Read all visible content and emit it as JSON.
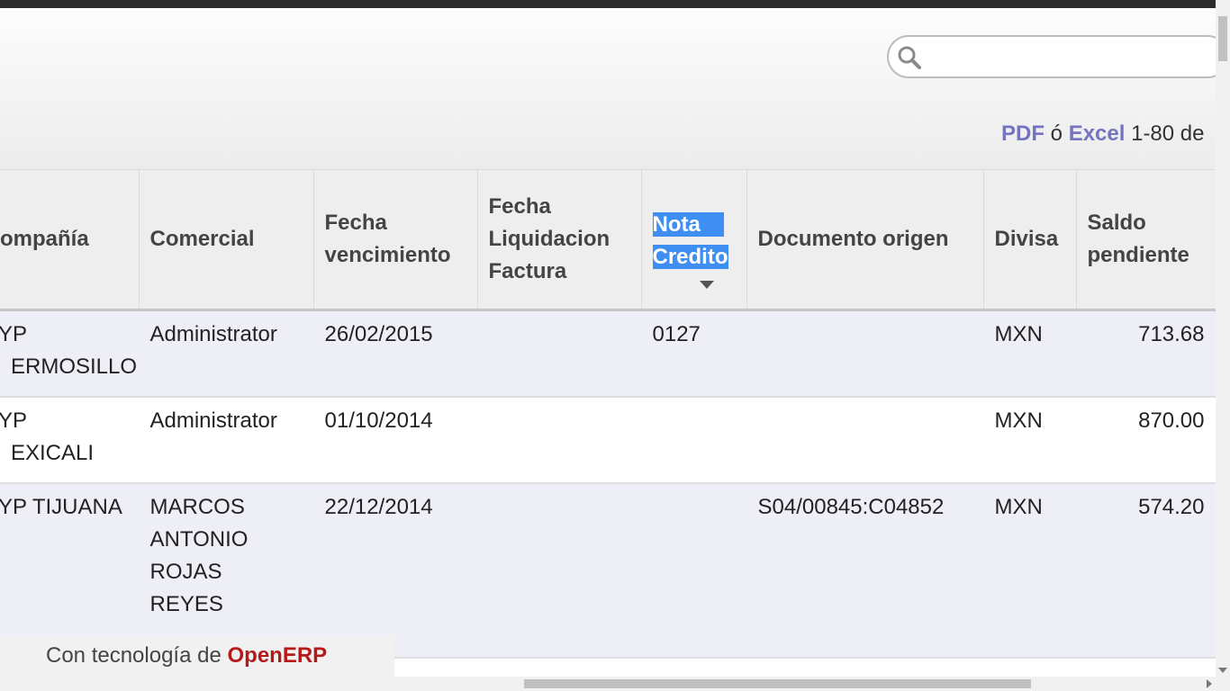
{
  "search": {
    "value": "",
    "placeholder": ""
  },
  "pager": {
    "pdf": "PDF",
    "sep": "ó",
    "excel": "Excel",
    "range": "1-80 de"
  },
  "columns": {
    "company": "ompañía",
    "salesperson": "Comercial",
    "due_date": [
      "Fecha",
      "vencimiento"
    ],
    "settlement_date": [
      "Fecha",
      "Liquidacion",
      "Factura"
    ],
    "credit_note": [
      "Nota",
      "Credito"
    ],
    "source_document": "Documento origen",
    "currency": "Divisa",
    "balance": [
      "Saldo",
      "pendiente"
    ]
  },
  "rows": [
    {
      "company": [
        "YP",
        "ERMOSILLO"
      ],
      "salesperson": [
        "Administrator"
      ],
      "due_date": "26/02/2015",
      "settlement_date": "",
      "credit_note": "0127",
      "source_document": "",
      "currency": "MXN",
      "balance": "713.68"
    },
    {
      "company": [
        "YP",
        "EXICALI"
      ],
      "salesperson": [
        "Administrator"
      ],
      "due_date": "01/10/2014",
      "settlement_date": "",
      "credit_note": "",
      "source_document": "",
      "currency": "MXN",
      "balance": "870.00"
    },
    {
      "company": [
        "YP TIJUANA"
      ],
      "salesperson": [
        "MARCOS",
        "ANTONIO",
        "ROJAS",
        "REYES"
      ],
      "due_date": "22/12/2014",
      "settlement_date": "",
      "credit_note": "",
      "source_document": "S04/00845:C04852",
      "currency": "MXN",
      "balance": "574.20"
    }
  ],
  "footer": {
    "prefix": "Con tecnología de",
    "brand": "OpenERP"
  },
  "colors": {
    "highlight": "#3f8ff2",
    "link": "#7474c0",
    "brand": "#b51a1a",
    "row_alt": "#eeeef6"
  }
}
